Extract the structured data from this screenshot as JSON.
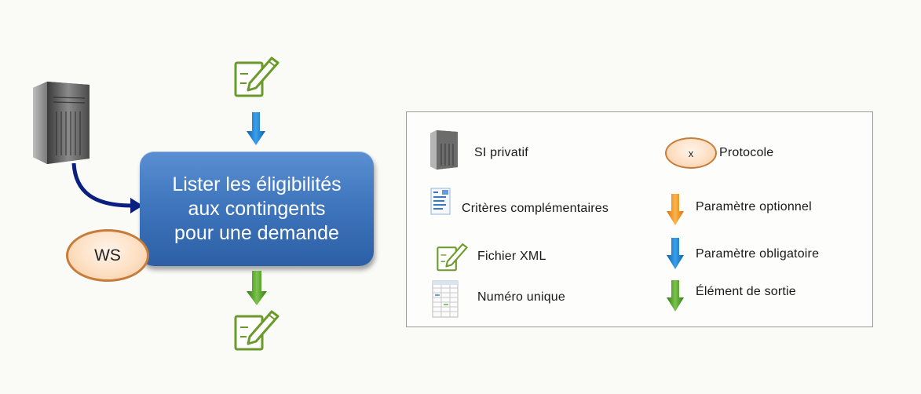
{
  "diagram": {
    "process_label": "Lister les éligibilités\naux contingents\npour une demande",
    "ws_label": "WS"
  },
  "legend": {
    "si_privatif": "SI privatif",
    "protocole": "Protocole",
    "protocole_symbol": "x",
    "criteres": "Critères complémentaires",
    "parametre_optionnel": "Paramètre optionnel",
    "fichier_xml": "Fichier XML",
    "parametre_obligatoire": "Paramètre obligatoire",
    "numero_unique": "Numéro unique",
    "element_sortie": "Élément de sortie"
  },
  "colors": {
    "process_box": "#3f76bd",
    "connector_arrow": "#0b1f80",
    "mandatory_arrow": "#1e7fd0",
    "optional_arrow": "#f5921f",
    "output_arrow": "#4a9a2a",
    "xml_icon": "#6a9a2a",
    "protocol_border": "#c77d3a"
  },
  "icons": {
    "server": "server-icon",
    "xml_file": "xml-file-pencil-icon",
    "criteria": "criteria-document-icon",
    "unique_number": "spreadsheet-icon"
  }
}
